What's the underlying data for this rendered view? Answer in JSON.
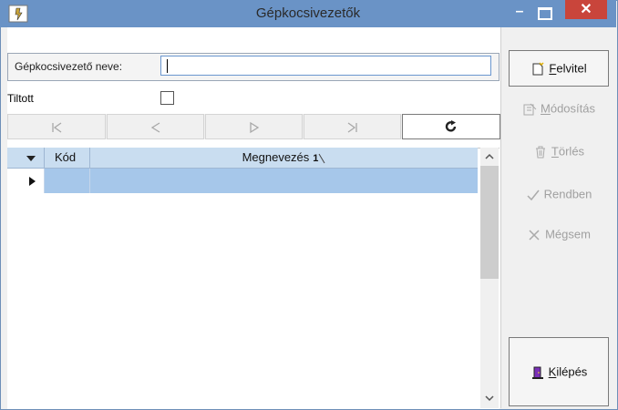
{
  "window": {
    "title": "Gépkocsivezetők",
    "controls": {
      "minimize": "–",
      "close": "✕"
    }
  },
  "form": {
    "name_label": "Gépkocsivezető neve:",
    "name_value": "",
    "tiltott_label": "Tiltott",
    "tiltott_checked": false
  },
  "navigator": {
    "first_icon": "first-record-icon",
    "prev_icon": "prev-record-icon",
    "next_icon": "next-record-icon",
    "last_icon": "last-record-icon",
    "refresh_icon": "refresh-icon"
  },
  "grid": {
    "columns": [
      {
        "label": "Kód"
      },
      {
        "label": "Megnevezés",
        "sort_badge": "1"
      }
    ],
    "rows": []
  },
  "sidebar": {
    "buttons": [
      {
        "key": "F",
        "rest": "elvitel",
        "enabled": true,
        "icon": "new-document-icon"
      },
      {
        "key": "M",
        "rest": "ódosítás",
        "enabled": false,
        "icon": "edit-document-icon"
      },
      {
        "key": "T",
        "rest": "örlés",
        "enabled": false,
        "icon": "trash-icon"
      },
      {
        "key": "",
        "rest": "Rendben",
        "enabled": false,
        "icon": "checkmark-icon"
      },
      {
        "key": "",
        "rest": "Mégsem",
        "enabled": false,
        "icon": "cancel-icon"
      },
      {
        "key": "K",
        "rest": "ilépés",
        "enabled": true,
        "icon": "exit-door-icon"
      }
    ]
  },
  "colors": {
    "titlebar": "#6a93c6",
    "close_button": "#c9453b",
    "grid_header": "#c9ddf0",
    "selected_row": "#a6c7ea"
  }
}
